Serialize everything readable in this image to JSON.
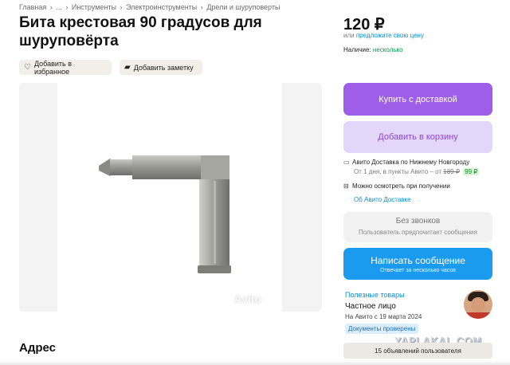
{
  "breadcrumbs": [
    "Главная",
    "›",
    "...",
    "›",
    "Инструменты",
    "›",
    "Электроинструменты",
    "›",
    "Дрели и шуруповерты"
  ],
  "title": "Бита крестовая 90 градусов для шуруповёрта",
  "actions": {
    "favorite": "Добавить в избранное",
    "note": "Добавить заметку"
  },
  "gallery": {
    "watermark": "Avito"
  },
  "address_heading": "Адрес",
  "price": "120 ₽",
  "offer": {
    "prefix": "или",
    "link": "предложите свою цену"
  },
  "availability": {
    "label": "Наличие:",
    "value": "несколько"
  },
  "buttons": {
    "buy": "Купить с доставкой",
    "cart": "Добавить в корзину",
    "message": "Написать сообщение",
    "message_sub": "Отвечает за несколько часов"
  },
  "delivery": {
    "line1": "Авито Доставка по Нижнему Новгороду",
    "line2_prefix": "От 1 дня, в пункты Авито – от",
    "old_price": "189 ₽",
    "new_price": "99 ₽",
    "inspect": "Можно осмотреть при получении",
    "about_link": "Об Авито Доставке"
  },
  "no_calls": {
    "title": "Без звонков",
    "subtitle": "Пользователь предпочитает сообщения"
  },
  "seller": {
    "goods_link": "Полезные товары",
    "name": "Частное лицо",
    "since": "На Авито с 19 марта 2024",
    "docs_badge": "Документы проверены",
    "listings": "15 объявлений пользователя"
  },
  "site_watermark": "YAPLAKAL.COM",
  "colors": {
    "buy_button": "#9e5ee8",
    "cart_button": "#e4d6f8",
    "message_button": "#1a9bf0",
    "link": "#0a8de0",
    "in_stock": "#00a046"
  },
  "icons": [
    "heart-icon",
    "note-icon",
    "delivery-truck-icon",
    "inspect-box-icon"
  ]
}
